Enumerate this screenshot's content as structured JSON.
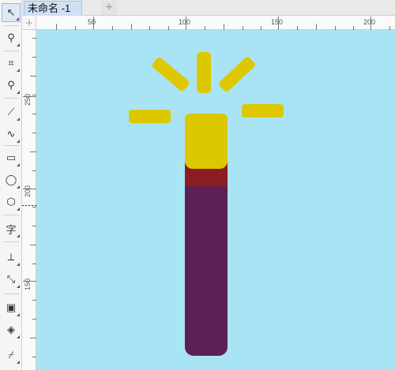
{
  "document_tab": {
    "title": "未命名 -1",
    "add_tab_symbol": "+"
  },
  "toolbox": {
    "tools": [
      {
        "name": "pick-tool",
        "glyph": "↖",
        "selected": true
      },
      {
        "name": "shape-tool",
        "glyph": "⚲"
      },
      {
        "name": "crop-tool",
        "glyph": "⌗"
      },
      {
        "name": "zoom-tool",
        "glyph": "⚲"
      },
      {
        "name": "freehand-tool",
        "glyph": "⟋"
      },
      {
        "name": "smart-drawing-tool",
        "glyph": "∿"
      },
      {
        "name": "rectangle-tool",
        "glyph": "▭"
      },
      {
        "name": "ellipse-tool",
        "glyph": "◯"
      },
      {
        "name": "polygon-tool",
        "glyph": "⬡"
      },
      {
        "name": "text-tool",
        "glyph": "字"
      },
      {
        "name": "dimension-tool",
        "glyph": "⟂"
      },
      {
        "name": "connector-tool",
        "glyph": "⤡"
      },
      {
        "name": "drop-shadow-tool",
        "glyph": "▣"
      },
      {
        "name": "fill-tool",
        "glyph": "◈"
      },
      {
        "name": "eyedropper-tool",
        "glyph": "⌿"
      }
    ]
  },
  "rulers": {
    "horizontal_labels": [
      "50",
      "100",
      "150",
      "200"
    ],
    "vertical_labels": [
      "250",
      "200",
      "150"
    ]
  },
  "colors": {
    "canvas_background": "#a9e4f5",
    "bulb_yellow": "#ddc800",
    "collar_red": "#8b1d25",
    "handle_purple": "#5d2055"
  }
}
